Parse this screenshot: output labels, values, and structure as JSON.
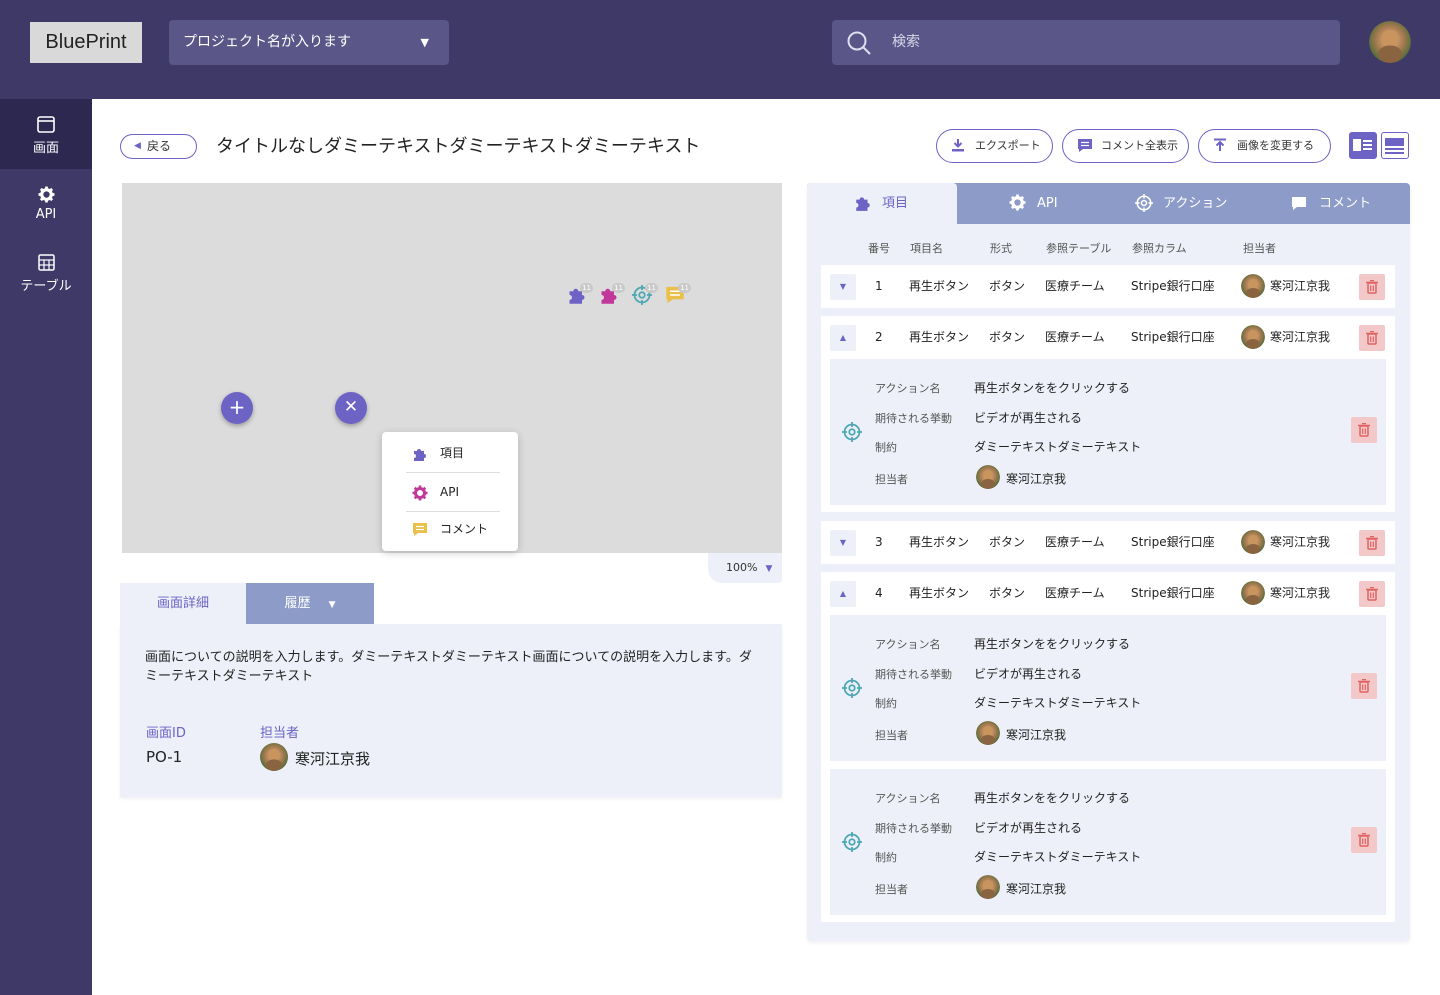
{
  "header": {
    "logo": "BluePrint",
    "project": "プロジェクト名が入ります",
    "search_placeholder": "検索"
  },
  "sidebar": {
    "items": [
      {
        "label": "画面",
        "icon": "screen-icon",
        "active": true
      },
      {
        "label": "API",
        "icon": "gear-icon",
        "active": false
      },
      {
        "label": "テーブル",
        "icon": "table-icon",
        "active": false
      }
    ]
  },
  "toolbar": {
    "back": "戻る",
    "title": "タイトルなしダミーテキストダミーテキストダミーテキスト",
    "export": "エクスポート",
    "show_comments": "コメント全表示",
    "change_image": "画像を変更する"
  },
  "canvas": {
    "zoom": "100%",
    "pin_counts": [
      "11",
      "11",
      "11",
      "11"
    ],
    "popup": [
      "項目",
      "API",
      "コメント"
    ]
  },
  "detail": {
    "tabs": [
      "画面詳細",
      "履歴"
    ],
    "description": "画面についての説明を入力します。ダミーテキストダミーテキスト画面についての説明を入力します。ダミーテキストダミーテキスト",
    "id_label": "画面ID",
    "id_value": "PO-1",
    "assignee_label": "担当者",
    "assignee_value": "寒河江京我"
  },
  "right": {
    "tabs": [
      "項目",
      "API",
      "アクション",
      "コメント"
    ],
    "columns": [
      "番号",
      "項目名",
      "形式",
      "参照テーブル",
      "参照カラム",
      "担当者"
    ],
    "rows": [
      {
        "no": "1",
        "name": "再生ボタン",
        "type": "ボタン",
        "table": "医療チーム",
        "column": "Stripe銀行口座",
        "assignee": "寒河江京我"
      },
      {
        "no": "2",
        "name": "再生ボタン",
        "type": "ボタン",
        "table": "医療チーム",
        "column": "Stripe銀行口座",
        "assignee": "寒河江京我"
      },
      {
        "no": "3",
        "name": "再生ボタン",
        "type": "ボタン",
        "table": "医療チーム",
        "column": "Stripe銀行口座",
        "assignee": "寒河江京我"
      },
      {
        "no": "4",
        "name": "再生ボタン",
        "type": "ボタン",
        "table": "医療チーム",
        "column": "Stripe銀行口座",
        "assignee": "寒河江京我"
      }
    ],
    "action_labels": [
      "アクション名",
      "期待される挙動",
      "制約",
      "担当者"
    ],
    "action": {
      "name": "再生ボタンををクリックする",
      "behavior": "ビデオが再生される",
      "constraint": "ダミーテキストダミーテキスト",
      "assignee": "寒河江京我"
    }
  },
  "colors": {
    "accent": "#6c63c5",
    "header_bg": "#3e3966",
    "tab_inactive": "#8d9bc9",
    "panel_bg": "#edf0f8"
  }
}
